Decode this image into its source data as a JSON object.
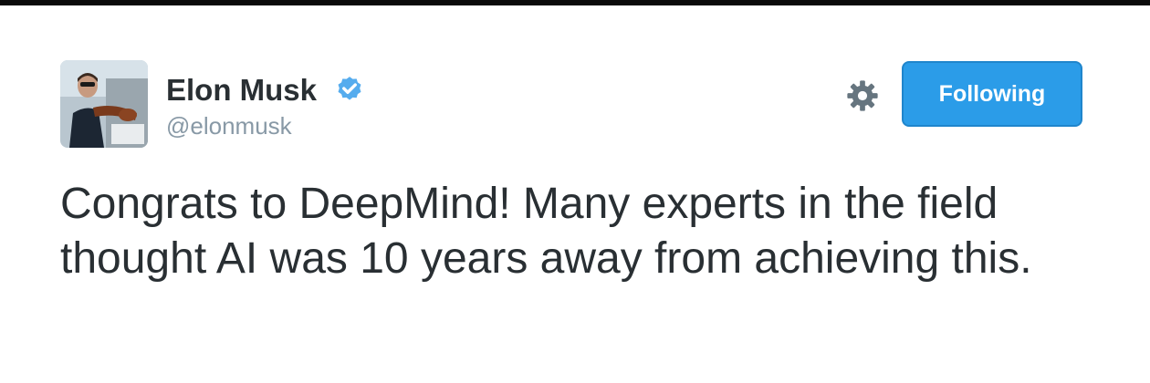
{
  "tweet": {
    "author": {
      "name": "Elon Musk",
      "handle": "@elonmusk",
      "verified": true
    },
    "text": "Congrats to DeepMind! Many experts in the field thought AI was 10 years away from achieving this."
  },
  "actions": {
    "follow_label": "Following"
  },
  "icons": {
    "verified": "verified-badge-icon",
    "settings": "gear-icon"
  },
  "colors": {
    "follow_button_bg": "#2b9ce8",
    "verified_badge": "#55acee",
    "name_text": "#292f33",
    "handle_text": "#8899a6",
    "gear": "#66757f"
  }
}
